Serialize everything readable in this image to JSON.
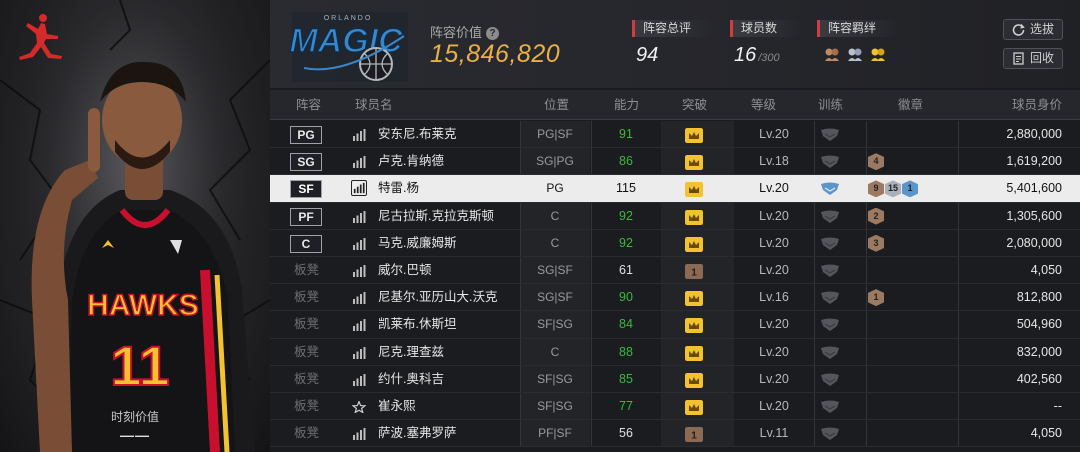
{
  "left_panel": {
    "moment_label": "时刻价值",
    "moment_value": "——",
    "jersey_team": "HAWKS",
    "jersey_number": "11",
    "brand_icon": "jumpman-logo-icon"
  },
  "header": {
    "team_logo_text": "MAGIC",
    "team_logo_subtext": "ORLANDO",
    "lineup_value_label": "阵容价值",
    "lineup_value": "15,846,820",
    "overall_label": "阵容总评",
    "overall_value": "94",
    "players_label": "球员数",
    "players_value": "16",
    "players_max": "/300",
    "bond_label": "阵容羁绊",
    "select_button": "选拔",
    "recycle_button": "回收"
  },
  "table": {
    "columns": [
      "阵容",
      "球员名",
      "位置",
      "能力",
      "突破",
      "等级",
      "训练",
      "徽章",
      "球员身价"
    ],
    "rows": [
      {
        "slot": "PG",
        "starter": true,
        "name": "安东尼.布莱克",
        "pos": "PG|SF",
        "ability": "91",
        "ability_color": "#3db83d",
        "breakthrough": "gold",
        "level": "Lv.20",
        "badges": [],
        "value": "2,880,000",
        "rank": "bars"
      },
      {
        "slot": "SG",
        "starter": true,
        "name": "卢克.肯纳德",
        "pos": "SG|PG",
        "ability": "86",
        "ability_color": "#3db83d",
        "breakthrough": "gold",
        "level": "Lv.18",
        "badges": [
          {
            "n": "4",
            "c": "#9c7a62"
          }
        ],
        "value": "1,619,200",
        "rank": "bars"
      },
      {
        "slot": "SF",
        "starter": true,
        "selected": true,
        "name": "特雷.杨",
        "pos": "PG",
        "ability": "115",
        "ability_color": "#111111",
        "breakthrough": "gold",
        "level": "Lv.20",
        "badges": [
          {
            "n": "9",
            "c": "#9c7a62"
          },
          {
            "n": "15",
            "c": "#a9b0ba"
          },
          {
            "n": "1",
            "c": "#5b95c9"
          }
        ],
        "value": "5,401,600",
        "rank": "bars",
        "trained": true
      },
      {
        "slot": "PF",
        "starter": true,
        "name": "尼古拉斯.克拉克斯顿",
        "pos": "C",
        "ability": "92",
        "ability_color": "#3db83d",
        "breakthrough": "gold",
        "level": "Lv.20",
        "badges": [
          {
            "n": "2",
            "c": "#9c7a62"
          }
        ],
        "value": "1,305,600",
        "rank": "bars"
      },
      {
        "slot": "C",
        "starter": true,
        "name": "马克.威廉姆斯",
        "pos": "C",
        "ability": "92",
        "ability_color": "#3db83d",
        "breakthrough": "gold",
        "level": "Lv.20",
        "badges": [
          {
            "n": "3",
            "c": "#9c7a62"
          }
        ],
        "value": "2,080,000",
        "rank": "bars"
      },
      {
        "slot": "板凳",
        "starter": false,
        "name": "威尔.巴顿",
        "pos": "SG|SF",
        "ability": "61",
        "ability_color": "#e0e0e0",
        "breakthrough": "bronze",
        "level": "Lv.20",
        "badges": [],
        "value": "4,050",
        "rank": "bars"
      },
      {
        "slot": "板凳",
        "starter": false,
        "name": "尼基尔.亚历山大.沃克",
        "pos": "SG|SF",
        "ability": "90",
        "ability_color": "#3db83d",
        "breakthrough": "gold",
        "level": "Lv.16",
        "badges": [
          {
            "n": "1",
            "c": "#9c7a62"
          }
        ],
        "value": "812,800",
        "rank": "bars"
      },
      {
        "slot": "板凳",
        "starter": false,
        "name": "凯莱布.休斯坦",
        "pos": "SF|SG",
        "ability": "84",
        "ability_color": "#3db83d",
        "breakthrough": "gold",
        "level": "Lv.20",
        "badges": [],
        "value": "504,960",
        "rank": "bars"
      },
      {
        "slot": "板凳",
        "starter": false,
        "name": "尼克.理查兹",
        "pos": "C",
        "ability": "88",
        "ability_color": "#3db83d",
        "breakthrough": "gold",
        "level": "Lv.20",
        "badges": [],
        "value": "832,000",
        "rank": "bars"
      },
      {
        "slot": "板凳",
        "starter": false,
        "name": "约什.奥科吉",
        "pos": "SF|SG",
        "ability": "85",
        "ability_color": "#3db83d",
        "breakthrough": "gold",
        "level": "Lv.20",
        "badges": [],
        "value": "402,560",
        "rank": "bars"
      },
      {
        "slot": "板凳",
        "starter": false,
        "name": "崔永熙",
        "pos": "SF|SG",
        "ability": "77",
        "ability_color": "#3db83d",
        "breakthrough": "gold",
        "level": "Lv.20",
        "badges": [],
        "value": "--",
        "rank": "star"
      },
      {
        "slot": "板凳",
        "starter": false,
        "name": "萨波.塞弗罗萨",
        "pos": "PF|SF",
        "ability": "56",
        "ability_color": "#e0e0e0",
        "breakthrough": "bronze",
        "level": "Lv.11",
        "badges": [],
        "value": "4,050",
        "rank": "bars"
      }
    ]
  },
  "colors": {
    "accent_gold": "#e8b045",
    "accent_red": "#d13c3c",
    "ability_green": "#3db83d",
    "break_gold": "#f2c230",
    "break_bronze": "#8b6a55"
  }
}
